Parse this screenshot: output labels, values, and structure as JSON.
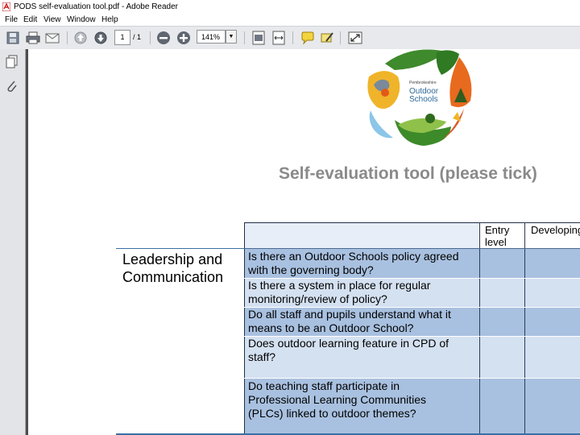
{
  "window": {
    "title": "PODS self-evaluation tool.pdf - Adobe Reader"
  },
  "menu": [
    "File",
    "Edit",
    "View",
    "Window",
    "Help"
  ],
  "toolbar": {
    "page_current": "1",
    "page_total": "/ 1",
    "zoom": "141%"
  },
  "logo": {
    "line1": "Pembrokeshire",
    "line2": "Outdoor",
    "line3": "Schools"
  },
  "document": {
    "title": "Self-evaluation tool (please tick)",
    "columns": [
      "Entry level",
      "Developing"
    ],
    "section": "Leadership and Communication",
    "questions": [
      "Is there an Outdoor Schools policy agreed with the governing body?",
      "Is there a system in place for regular monitoring/review of policy?",
      "Do all staff and pupils understand what it means to be an Outdoor School?",
      "Does outdoor learning feature in CPD of staff?",
      "Do teaching staff participate in Professional Learning Communities (PLCs) linked to outdoor themes?"
    ]
  },
  "colors": {
    "row_dark": "#a9c1e0",
    "row_light": "#d4e1f1",
    "header_bg": "#e8eef7",
    "title_gray": "#8a8a8a",
    "toolbar_bg": "#e8e9ec"
  }
}
